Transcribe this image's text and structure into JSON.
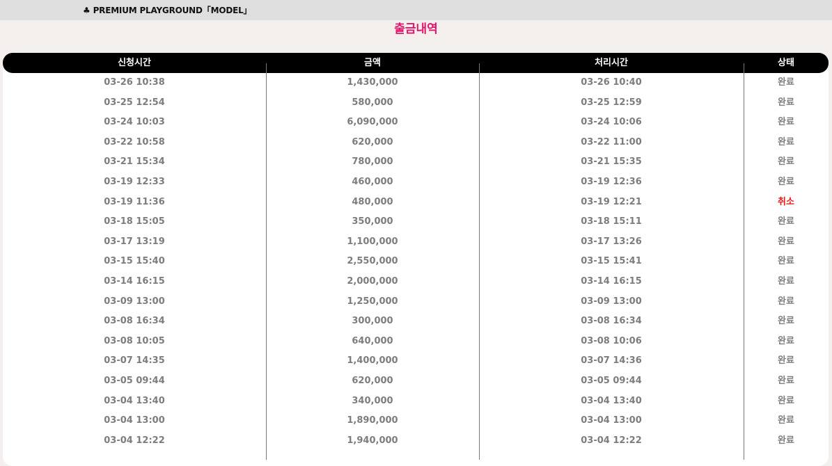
{
  "topbar": {
    "club_icon": "♣",
    "brand": "PREMIUM PLAYGROUND「MODEL」"
  },
  "page_title": "출금내역",
  "table": {
    "headers": [
      "신청시간",
      "금액",
      "처리시간",
      "상태"
    ],
    "rows": [
      {
        "requested": "03-26 10:38",
        "amount": "1,430,000",
        "processed": "03-26 10:40",
        "status": "완료"
      },
      {
        "requested": "03-25 12:54",
        "amount": "580,000",
        "processed": "03-25 12:59",
        "status": "완료"
      },
      {
        "requested": "03-24 10:03",
        "amount": "6,090,000",
        "processed": "03-24 10:06",
        "status": "완료"
      },
      {
        "requested": "03-22 10:58",
        "amount": "620,000",
        "processed": "03-22 11:00",
        "status": "완료"
      },
      {
        "requested": "03-21 15:34",
        "amount": "780,000",
        "processed": "03-21 15:35",
        "status": "완료"
      },
      {
        "requested": "03-19 12:33",
        "amount": "460,000",
        "processed": "03-19 12:36",
        "status": "완료"
      },
      {
        "requested": "03-19 11:36",
        "amount": "480,000",
        "processed": "03-19 12:21",
        "status": "취소"
      },
      {
        "requested": "03-18 15:05",
        "amount": "350,000",
        "processed": "03-18 15:11",
        "status": "완료"
      },
      {
        "requested": "03-17 13:19",
        "amount": "1,100,000",
        "processed": "03-17 13:26",
        "status": "완료"
      },
      {
        "requested": "03-15 15:40",
        "amount": "2,550,000",
        "processed": "03-15 15:41",
        "status": "완료"
      },
      {
        "requested": "03-14 16:15",
        "amount": "2,000,000",
        "processed": "03-14 16:15",
        "status": "완료"
      },
      {
        "requested": "03-09 13:00",
        "amount": "1,250,000",
        "processed": "03-09 13:00",
        "status": "완료"
      },
      {
        "requested": "03-08 16:34",
        "amount": "300,000",
        "processed": "03-08 16:34",
        "status": "완료"
      },
      {
        "requested": "03-08 10:05",
        "amount": "640,000",
        "processed": "03-08 10:06",
        "status": "완료"
      },
      {
        "requested": "03-07 14:35",
        "amount": "1,400,000",
        "processed": "03-07 14:36",
        "status": "완료"
      },
      {
        "requested": "03-05 09:44",
        "amount": "620,000",
        "processed": "03-05 09:44",
        "status": "완료"
      },
      {
        "requested": "03-04 13:40",
        "amount": "340,000",
        "processed": "03-04 13:40",
        "status": "완료"
      },
      {
        "requested": "03-04 13:00",
        "amount": "1,890,000",
        "processed": "03-04 13:00",
        "status": "완료"
      },
      {
        "requested": "03-04 12:22",
        "amount": "1,940,000",
        "processed": "03-04 12:22",
        "status": "완료"
      }
    ]
  },
  "colors": {
    "title": "#e3126b",
    "cancel": "#e81b1b",
    "text": "#7d7d7d",
    "header_bg": "#000000"
  }
}
